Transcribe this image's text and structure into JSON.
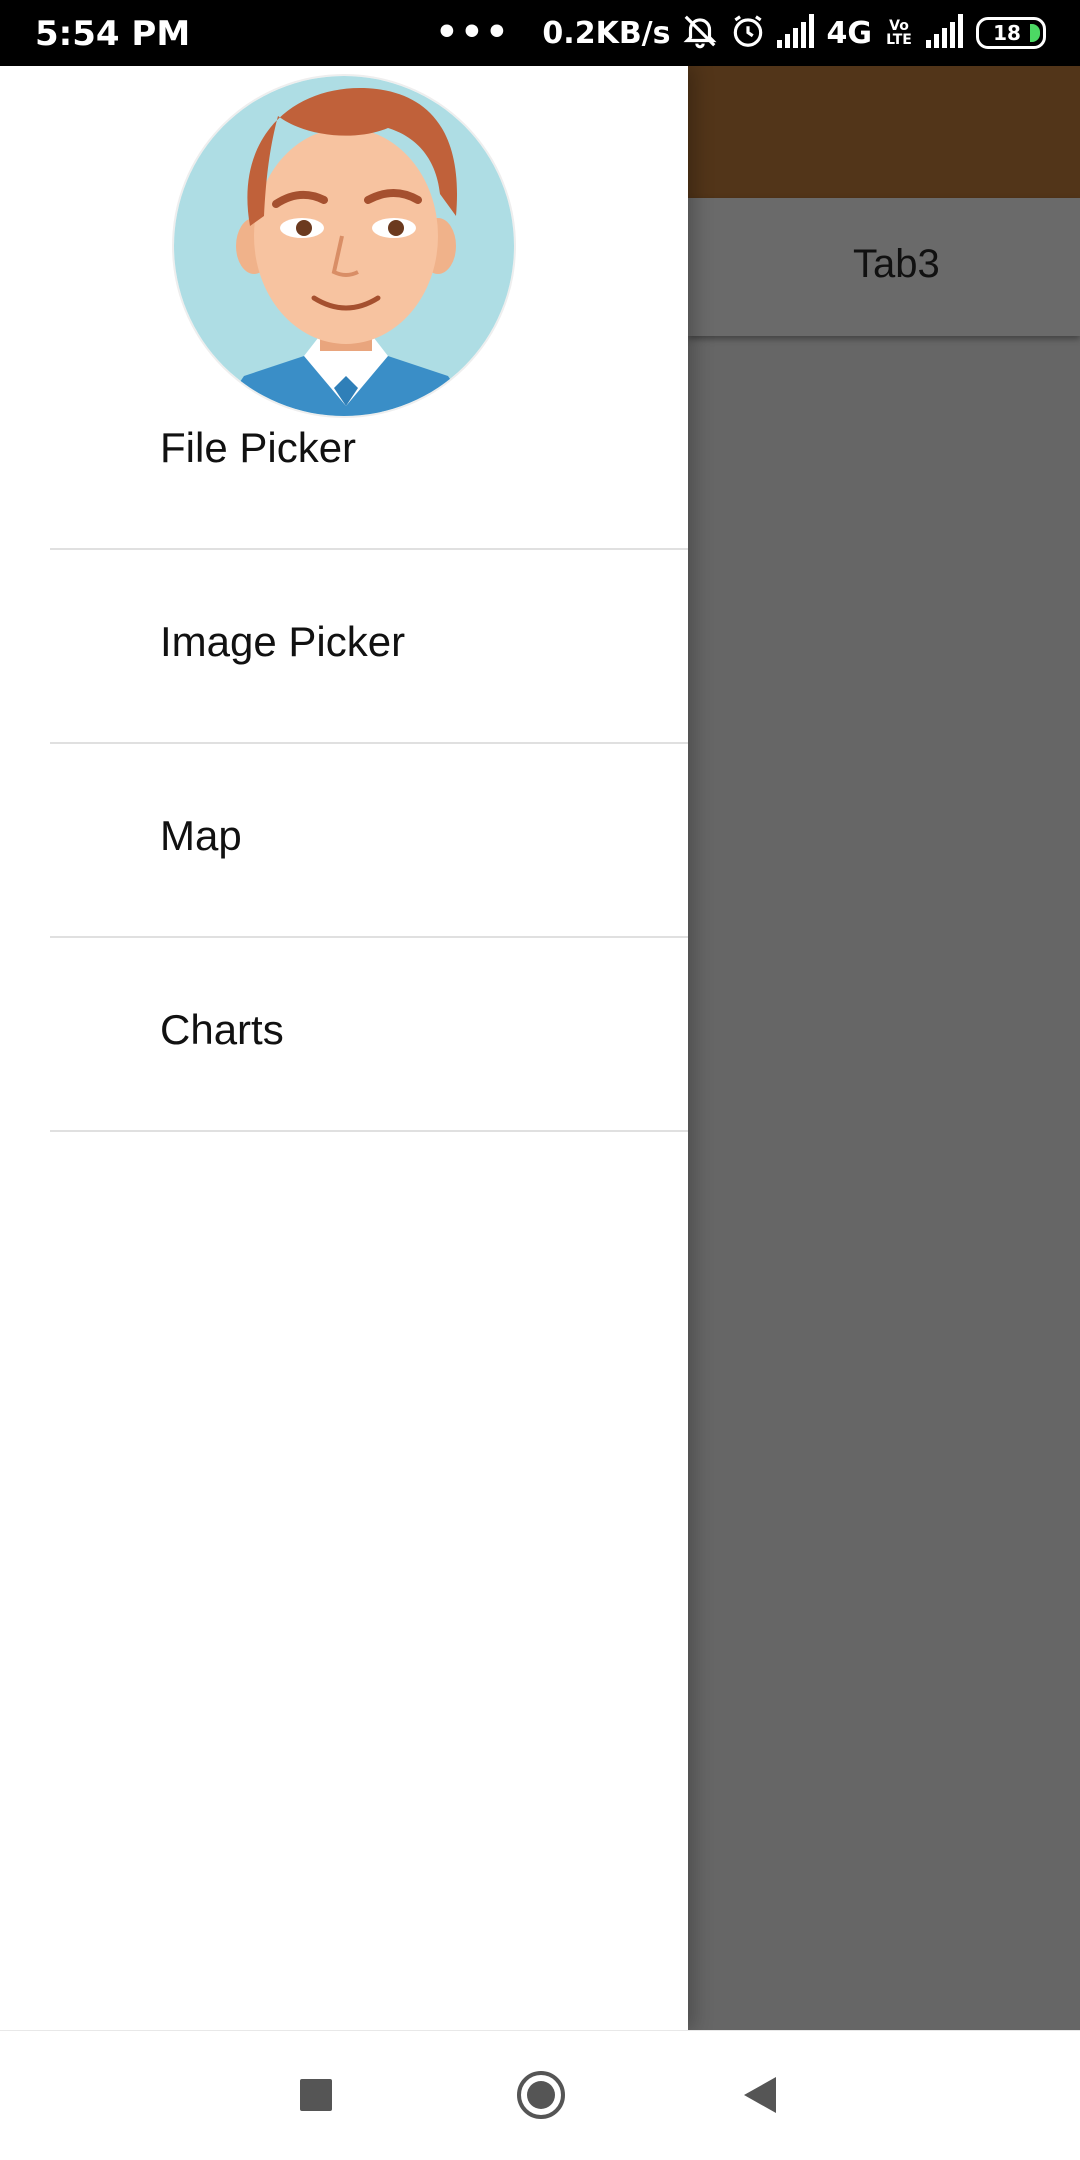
{
  "status_bar": {
    "time": "5:54 PM",
    "more": "•••",
    "speed": "0.2KB/s",
    "network": "4G",
    "volte": "Vo LTE",
    "battery": "18"
  },
  "app": {
    "tab3_label": "Tab3",
    "appbar_color": "#523519"
  },
  "drawer": {
    "items": [
      {
        "label": "File Picker"
      },
      {
        "label": "Image Picker"
      },
      {
        "label": "Map"
      },
      {
        "label": "Charts"
      }
    ]
  },
  "nav_bar": {
    "icons": [
      "recents-icon",
      "home-icon",
      "back-icon"
    ]
  }
}
